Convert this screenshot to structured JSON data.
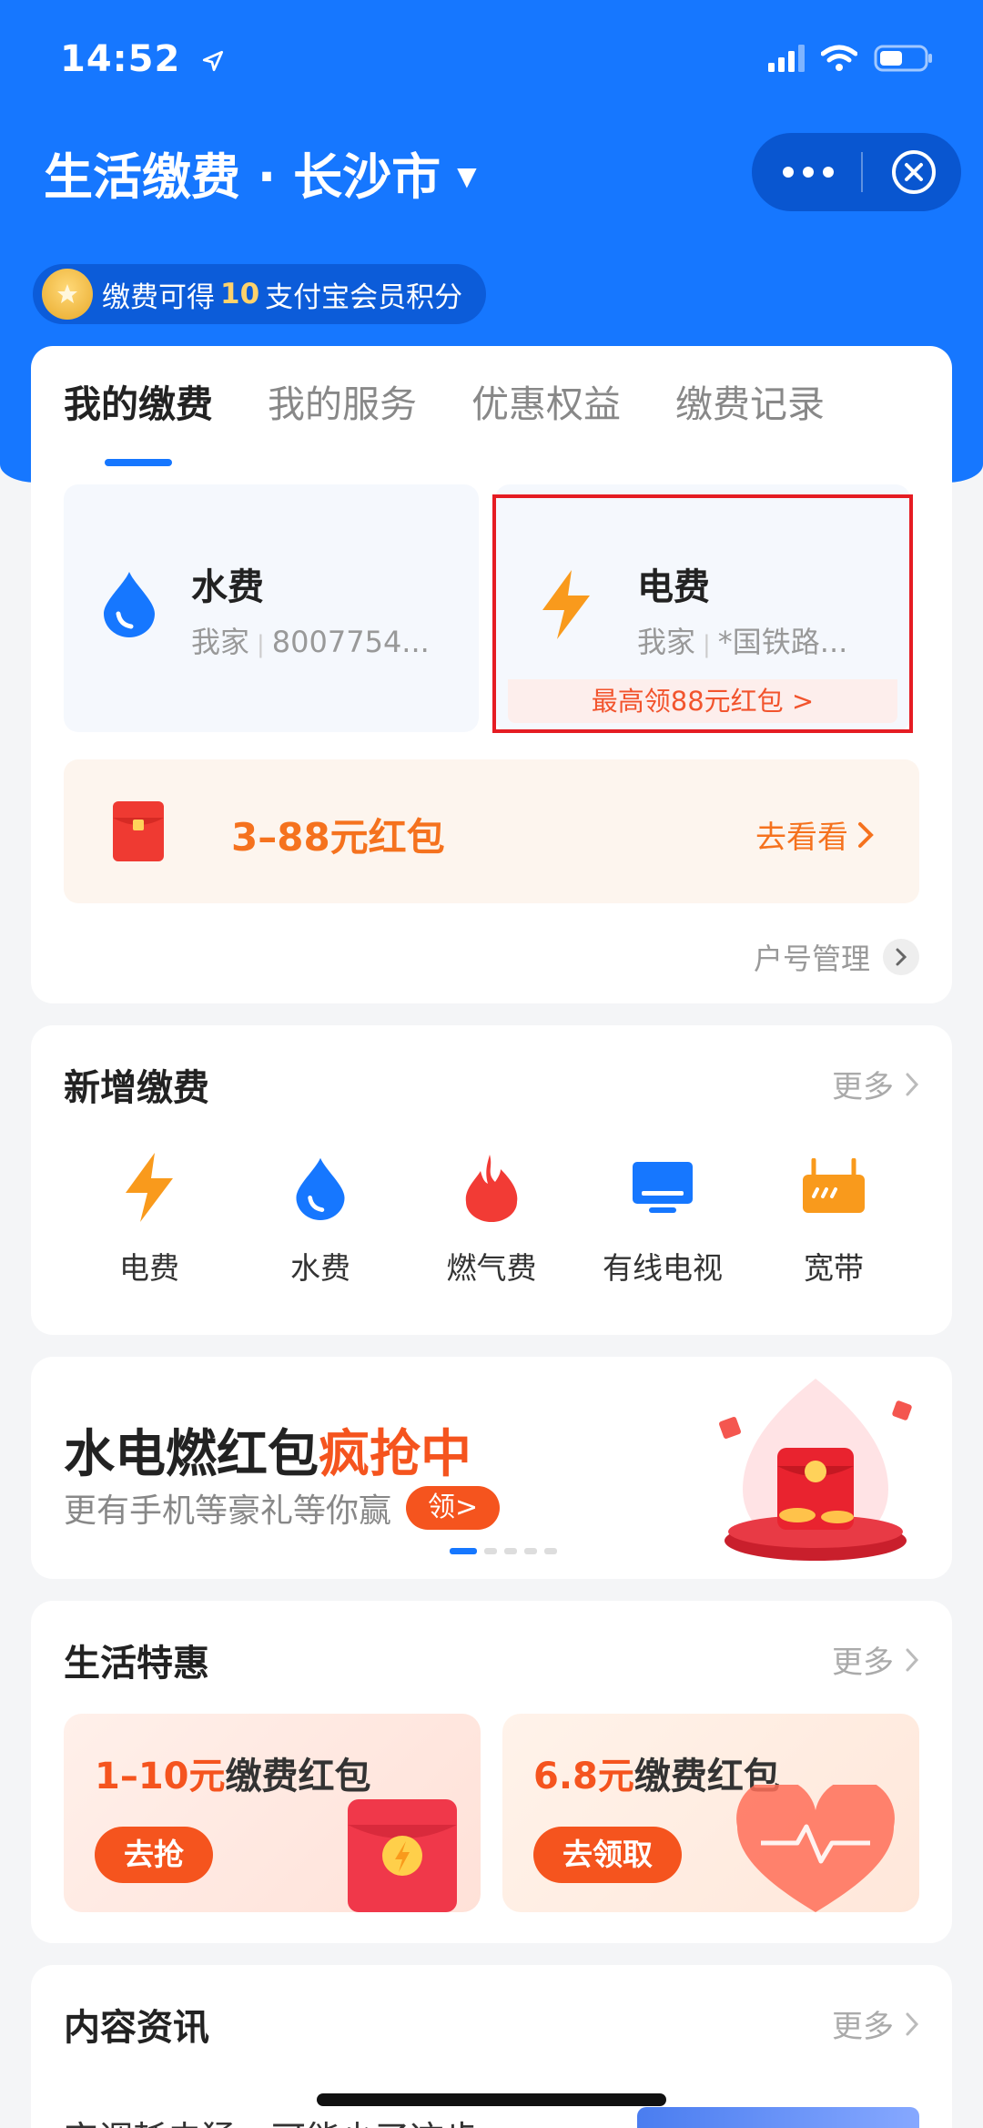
{
  "status": {
    "time": "14:52"
  },
  "header": {
    "title": "生活缴费 · 长沙市"
  },
  "points": {
    "prefix": "缴费可得",
    "num": "10",
    "suffix": "支付宝会员积分"
  },
  "tabs": [
    {
      "label": "我的缴费",
      "active": true
    },
    {
      "label": "我的服务",
      "active": false
    },
    {
      "label": "优惠权益",
      "active": false
    },
    {
      "label": "缴费记录",
      "active": false
    }
  ],
  "bills": {
    "water": {
      "name": "水费",
      "owner": "我家",
      "account": "8007754..."
    },
    "electric": {
      "name": "电费",
      "owner": "我家",
      "account": "*国铁路...",
      "promo": "最高领88元红包 >"
    }
  },
  "redpack": {
    "text": "3–88元红包",
    "link": "去看看"
  },
  "account_mgmt": "户号管理",
  "new_payment": {
    "title": "新增缴费",
    "more": "更多",
    "items": [
      {
        "label": "电费",
        "icon": "bolt-icon"
      },
      {
        "label": "水费",
        "icon": "water-drop-icon"
      },
      {
        "label": "燃气费",
        "icon": "flame-icon"
      },
      {
        "label": "有线电视",
        "icon": "tv-icon"
      },
      {
        "label": "宽带",
        "icon": "router-icon"
      }
    ]
  },
  "banner": {
    "title_a": "水电燃红包",
    "title_b": "疯抢中",
    "sub": "更有手机等豪礼等你赢",
    "button": "领>"
  },
  "deals": {
    "title": "生活特惠",
    "more": "更多",
    "items": [
      {
        "amount": "1–10元",
        "label": "缴费红包",
        "button": "去抢"
      },
      {
        "amount": "6.8元",
        "label": "缴费红包",
        "button": "去领取"
      }
    ]
  },
  "news": {
    "title": "内容资讯",
    "more": "更多",
    "first_line": "空调耗电猛，可能少了这步"
  },
  "colors": {
    "brand_blue": "#1677ff",
    "accent_orange": "#f5541e",
    "highlight_red": "#e51c23"
  }
}
